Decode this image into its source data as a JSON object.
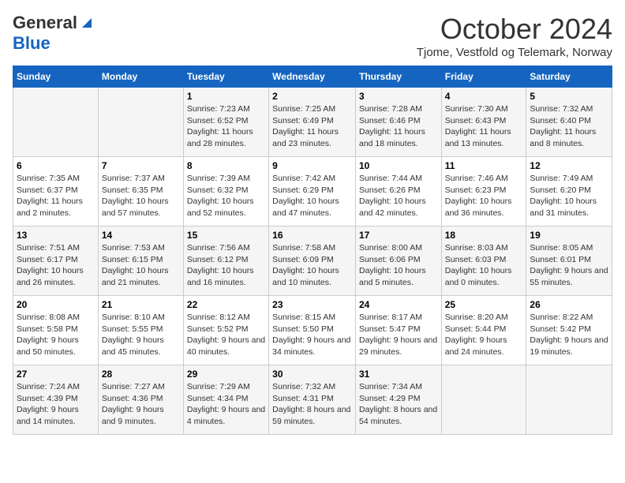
{
  "header": {
    "logo_general": "General",
    "logo_blue": "Blue",
    "month": "October 2024",
    "location": "Tjome, Vestfold og Telemark, Norway"
  },
  "days_of_week": [
    "Sunday",
    "Monday",
    "Tuesday",
    "Wednesday",
    "Thursday",
    "Friday",
    "Saturday"
  ],
  "weeks": [
    [
      {
        "day": "",
        "content": ""
      },
      {
        "day": "",
        "content": ""
      },
      {
        "day": "1",
        "content": "Sunrise: 7:23 AM\nSunset: 6:52 PM\nDaylight: 11 hours and 28 minutes."
      },
      {
        "day": "2",
        "content": "Sunrise: 7:25 AM\nSunset: 6:49 PM\nDaylight: 11 hours and 23 minutes."
      },
      {
        "day": "3",
        "content": "Sunrise: 7:28 AM\nSunset: 6:46 PM\nDaylight: 11 hours and 18 minutes."
      },
      {
        "day": "4",
        "content": "Sunrise: 7:30 AM\nSunset: 6:43 PM\nDaylight: 11 hours and 13 minutes."
      },
      {
        "day": "5",
        "content": "Sunrise: 7:32 AM\nSunset: 6:40 PM\nDaylight: 11 hours and 8 minutes."
      }
    ],
    [
      {
        "day": "6",
        "content": "Sunrise: 7:35 AM\nSunset: 6:37 PM\nDaylight: 11 hours and 2 minutes."
      },
      {
        "day": "7",
        "content": "Sunrise: 7:37 AM\nSunset: 6:35 PM\nDaylight: 10 hours and 57 minutes."
      },
      {
        "day": "8",
        "content": "Sunrise: 7:39 AM\nSunset: 6:32 PM\nDaylight: 10 hours and 52 minutes."
      },
      {
        "day": "9",
        "content": "Sunrise: 7:42 AM\nSunset: 6:29 PM\nDaylight: 10 hours and 47 minutes."
      },
      {
        "day": "10",
        "content": "Sunrise: 7:44 AM\nSunset: 6:26 PM\nDaylight: 10 hours and 42 minutes."
      },
      {
        "day": "11",
        "content": "Sunrise: 7:46 AM\nSunset: 6:23 PM\nDaylight: 10 hours and 36 minutes."
      },
      {
        "day": "12",
        "content": "Sunrise: 7:49 AM\nSunset: 6:20 PM\nDaylight: 10 hours and 31 minutes."
      }
    ],
    [
      {
        "day": "13",
        "content": "Sunrise: 7:51 AM\nSunset: 6:17 PM\nDaylight: 10 hours and 26 minutes."
      },
      {
        "day": "14",
        "content": "Sunrise: 7:53 AM\nSunset: 6:15 PM\nDaylight: 10 hours and 21 minutes."
      },
      {
        "day": "15",
        "content": "Sunrise: 7:56 AM\nSunset: 6:12 PM\nDaylight: 10 hours and 16 minutes."
      },
      {
        "day": "16",
        "content": "Sunrise: 7:58 AM\nSunset: 6:09 PM\nDaylight: 10 hours and 10 minutes."
      },
      {
        "day": "17",
        "content": "Sunrise: 8:00 AM\nSunset: 6:06 PM\nDaylight: 10 hours and 5 minutes."
      },
      {
        "day": "18",
        "content": "Sunrise: 8:03 AM\nSunset: 6:03 PM\nDaylight: 10 hours and 0 minutes."
      },
      {
        "day": "19",
        "content": "Sunrise: 8:05 AM\nSunset: 6:01 PM\nDaylight: 9 hours and 55 minutes."
      }
    ],
    [
      {
        "day": "20",
        "content": "Sunrise: 8:08 AM\nSunset: 5:58 PM\nDaylight: 9 hours and 50 minutes."
      },
      {
        "day": "21",
        "content": "Sunrise: 8:10 AM\nSunset: 5:55 PM\nDaylight: 9 hours and 45 minutes."
      },
      {
        "day": "22",
        "content": "Sunrise: 8:12 AM\nSunset: 5:52 PM\nDaylight: 9 hours and 40 minutes."
      },
      {
        "day": "23",
        "content": "Sunrise: 8:15 AM\nSunset: 5:50 PM\nDaylight: 9 hours and 34 minutes."
      },
      {
        "day": "24",
        "content": "Sunrise: 8:17 AM\nSunset: 5:47 PM\nDaylight: 9 hours and 29 minutes."
      },
      {
        "day": "25",
        "content": "Sunrise: 8:20 AM\nSunset: 5:44 PM\nDaylight: 9 hours and 24 minutes."
      },
      {
        "day": "26",
        "content": "Sunrise: 8:22 AM\nSunset: 5:42 PM\nDaylight: 9 hours and 19 minutes."
      }
    ],
    [
      {
        "day": "27",
        "content": "Sunrise: 7:24 AM\nSunset: 4:39 PM\nDaylight: 9 hours and 14 minutes."
      },
      {
        "day": "28",
        "content": "Sunrise: 7:27 AM\nSunset: 4:36 PM\nDaylight: 9 hours and 9 minutes."
      },
      {
        "day": "29",
        "content": "Sunrise: 7:29 AM\nSunset: 4:34 PM\nDaylight: 9 hours and 4 minutes."
      },
      {
        "day": "30",
        "content": "Sunrise: 7:32 AM\nSunset: 4:31 PM\nDaylight: 8 hours and 59 minutes."
      },
      {
        "day": "31",
        "content": "Sunrise: 7:34 AM\nSunset: 4:29 PM\nDaylight: 8 hours and 54 minutes."
      },
      {
        "day": "",
        "content": ""
      },
      {
        "day": "",
        "content": ""
      }
    ]
  ]
}
